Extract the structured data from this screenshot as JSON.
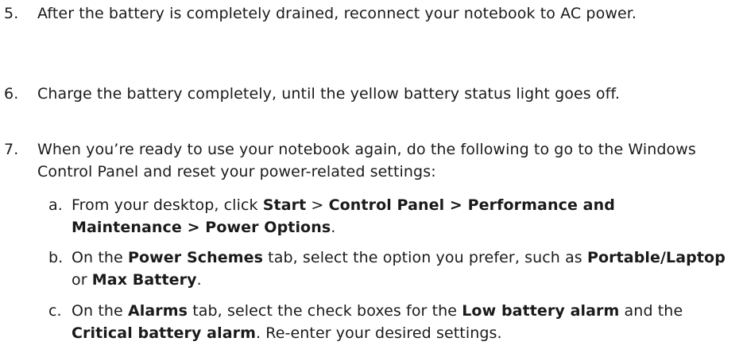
{
  "steps": [
    {
      "number": "5.",
      "text": "After the battery is completely drained, reconnect your notebook to AC power."
    },
    {
      "number": "6.",
      "text": "Charge the battery completely, until the yellow battery status light goes off."
    },
    {
      "number": "7.",
      "text": "When you’re ready to use your notebook again, do the following to go to the Windows Control Panel and reset your power-related settings:",
      "substeps": [
        {
          "letter": "a.",
          "t1": "From your desktop, click ",
          "b1": "Start",
          "t2": " > ",
          "b2": "Control Panel > Performance and Maintenance > Power Options",
          "t3": "."
        },
        {
          "letter": "b.",
          "t1": "On the ",
          "b1": "Power Schemes",
          "t2": " tab, select the option you prefer, such as ",
          "b2": "Portable/Laptop",
          "t3": " or ",
          "b3": "Max Battery",
          "t4": "."
        },
        {
          "letter": "c.",
          "t1": "On the ",
          "b1": "Alarms",
          "t2": " tab, select the check boxes for the ",
          "b2": "Low battery alarm",
          "t3": " and the ",
          "b3": "Critical battery alarm",
          "t4": ". Re-enter your desired settings."
        }
      ]
    }
  ]
}
